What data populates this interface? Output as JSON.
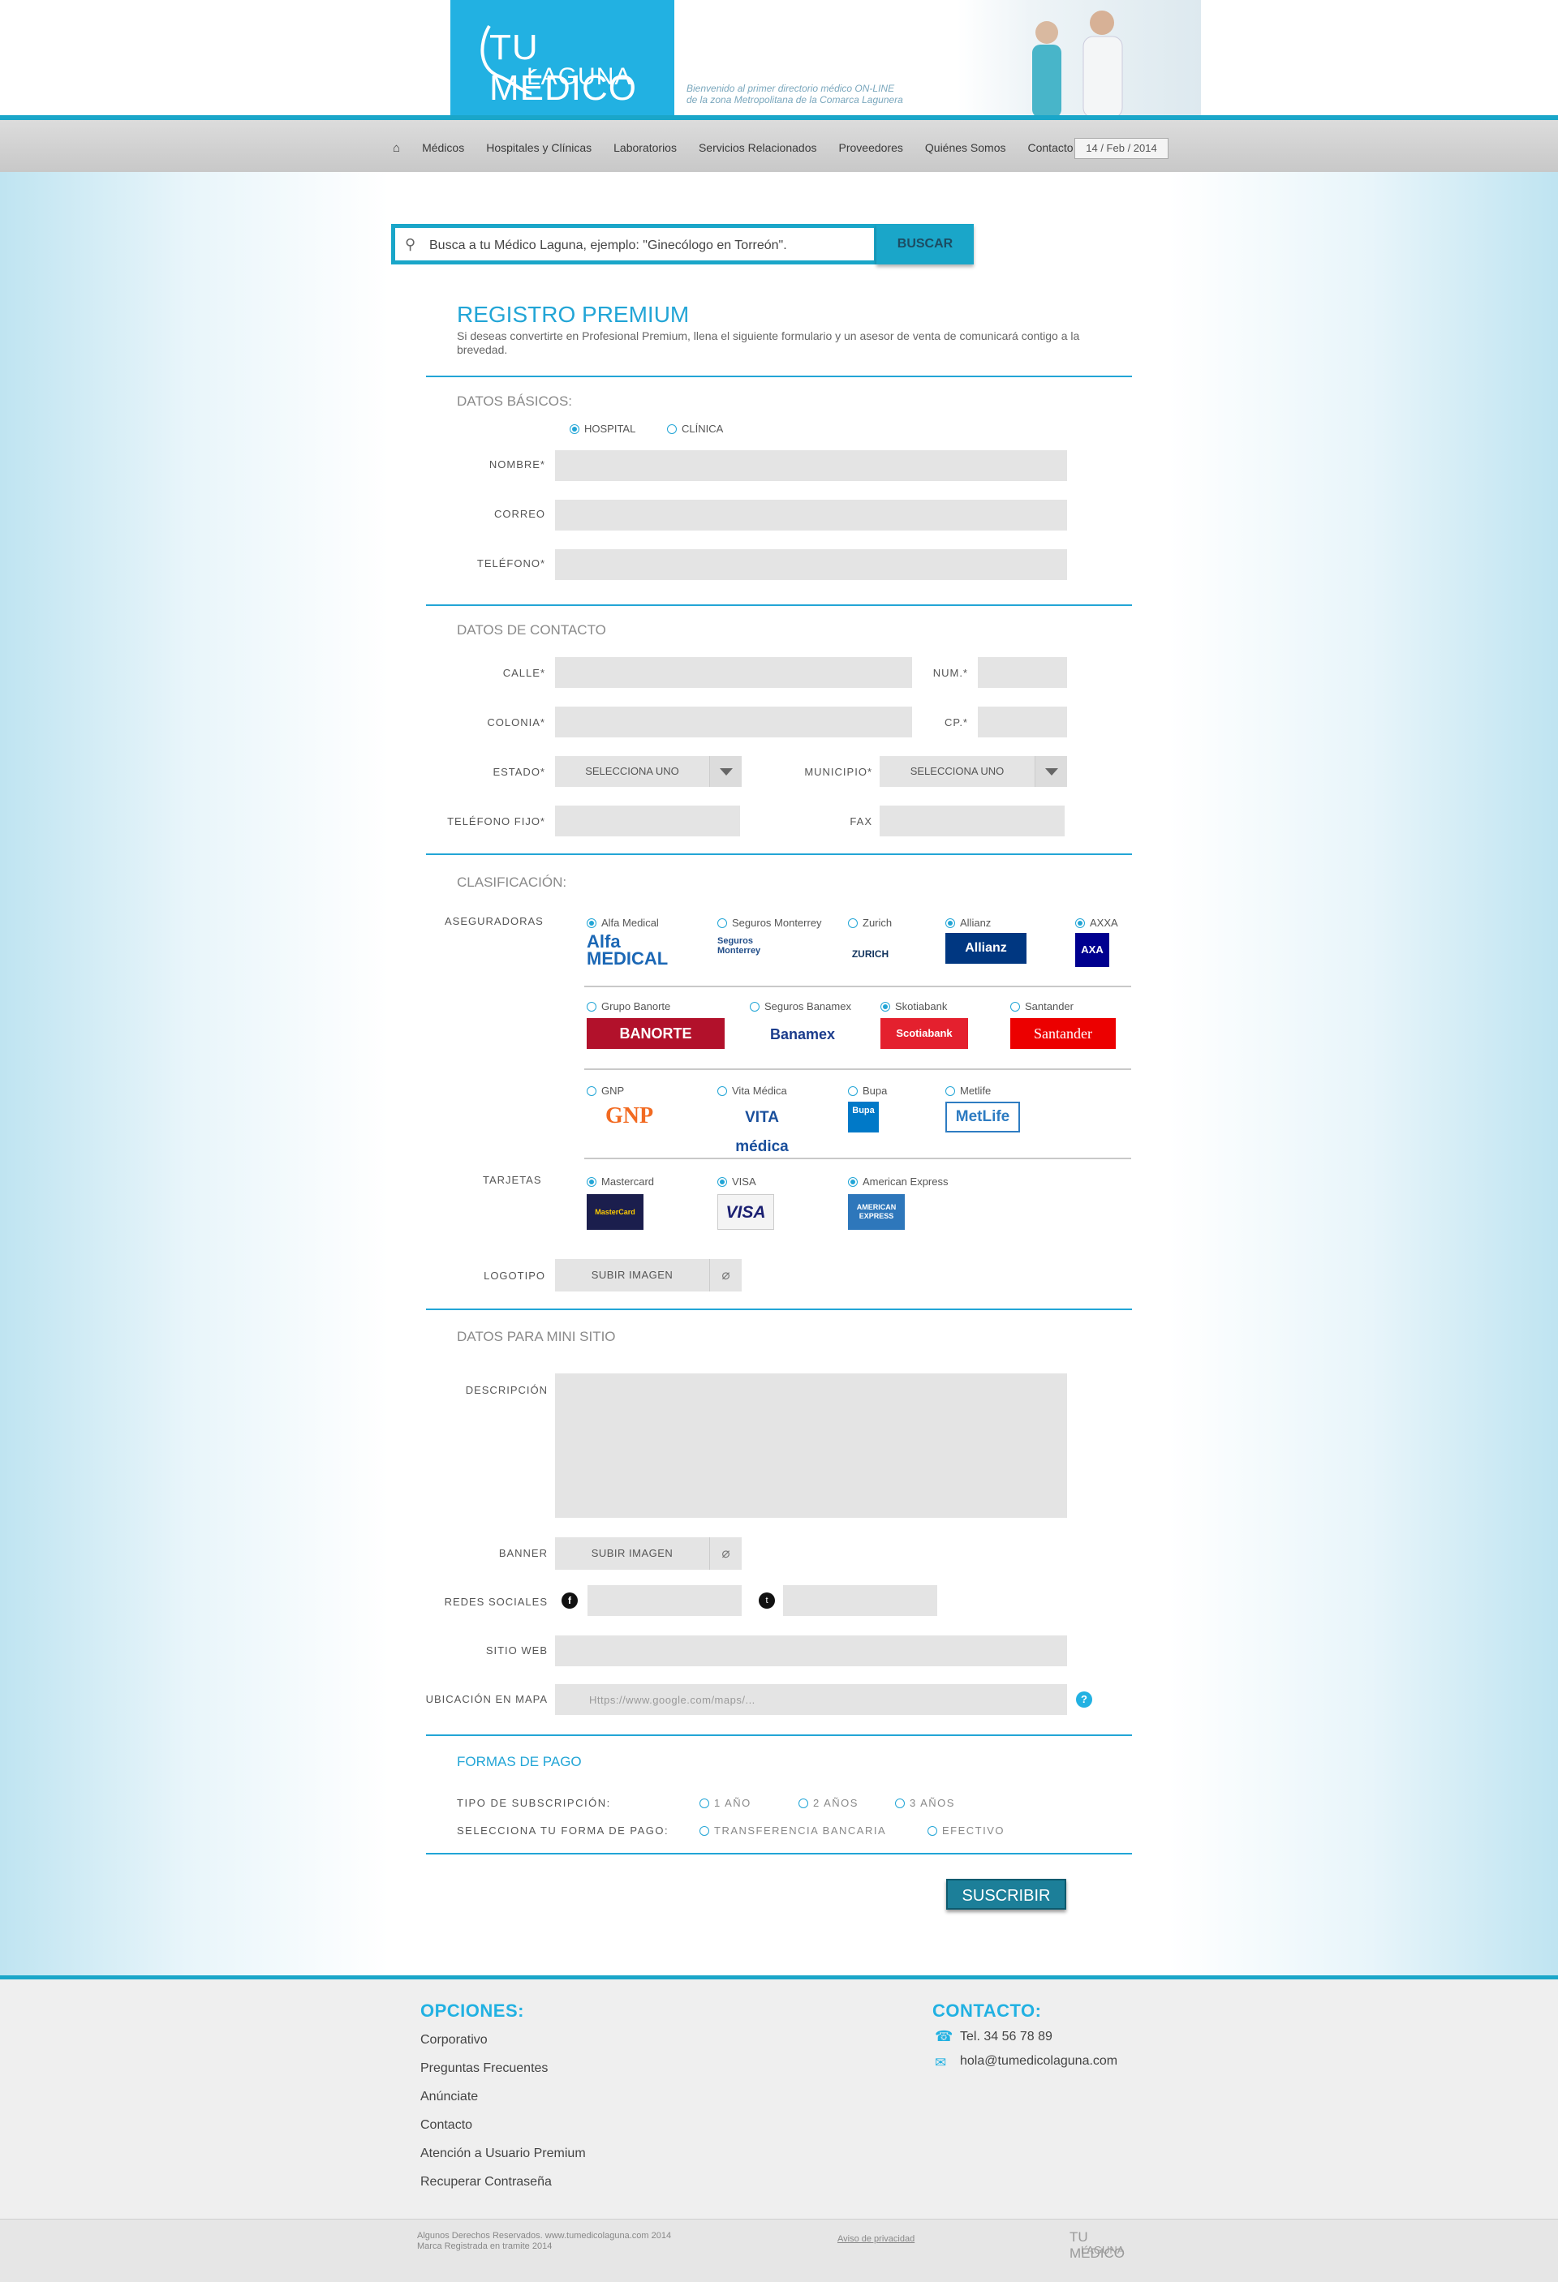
{
  "header": {
    "logo_line1": "TU MÉDICO",
    "logo_line2": "LAGUNA",
    "tagline1": "Bienvenido al primer directorio médico ON-LINE",
    "tagline2": "de la zona Metropolitana de la Comarca Lagunera"
  },
  "nav": {
    "items": [
      "Médicos",
      "Hospitales y Clínicas",
      "Laboratorios",
      "Servicios Relacionados",
      "Proveedores",
      "Quiénes Somos",
      "Contacto"
    ],
    "date": "14 / Feb / 2014"
  },
  "search": {
    "placeholder": "Busca a tu Médico Laguna, ejemplo: \"Ginecólogo en Torreón\".",
    "button": "BUSCAR"
  },
  "form": {
    "title": "REGISTRO PREMIUM",
    "intro": "Si deseas convertirte en Profesional Premium, llena el siguiente formulario y un asesor de venta de comunicará contigo a la brevedad.",
    "basic": {
      "section": "DATOS BÁSICOS:",
      "type_hospital": "HOSPITAL",
      "type_clinica": "CLÍNICA",
      "nombre": "NOMBRE*",
      "correo": "CORREO",
      "telefono": "TELÉFONO*"
    },
    "contact": {
      "section": "DATOS DE CONTACTO",
      "calle": "CALLE*",
      "num": "NUM.*",
      "colonia": "COLONIA*",
      "cp": "CP.*",
      "estado": "ESTADO*",
      "estado_value": "SELECCIONA UNO",
      "municipio": "MUNICIPIO*",
      "municipio_value": "SELECCIONA UNO",
      "tel_fijo": "TELÉFONO FIJO*",
      "fax": "FAX"
    },
    "classification": {
      "section": "CLASIFICACIÓN:",
      "aseguradoras": "ASEGURADORAS",
      "insurers": [
        {
          "name": "Alfa Medical",
          "logo": "Alfa MEDICAL"
        },
        {
          "name": "Seguros Monterrey",
          "logo": "Seguros Monterrey"
        },
        {
          "name": "Zurich",
          "logo": "ZURICH"
        },
        {
          "name": "Allianz",
          "logo": "Allianz"
        },
        {
          "name": "AXXA",
          "logo": "AXA"
        },
        {
          "name": "Grupo Banorte",
          "logo": "BANORTE"
        },
        {
          "name": "Seguros Banamex",
          "logo": "Banamex"
        },
        {
          "name": "Skotiabank",
          "logo": "Scotiabank"
        },
        {
          "name": "Santander",
          "logo": "Santander"
        },
        {
          "name": "GNP",
          "logo": "GNP"
        },
        {
          "name": "Vita Médica",
          "logo": "VITA médica"
        },
        {
          "name": "Bupa",
          "logo": "Bupa"
        },
        {
          "name": "Metlife",
          "logo": "MetLife"
        }
      ],
      "tarjetas": "TARJETAS",
      "cards": [
        {
          "name": "Mastercard",
          "logo": "MasterCard"
        },
        {
          "name": "VISA",
          "logo": "VISA"
        },
        {
          "name": "American Express",
          "logo": "AMERICAN EXPRESS"
        }
      ],
      "logotipo": "LOGOTIPO",
      "upload": "SUBIR IMAGEN"
    },
    "mini": {
      "section": "DATOS PARA MINI SITIO",
      "descripcion": "DESCRIPCIÓN",
      "banner": "BANNER",
      "upload": "SUBIR IMAGEN",
      "redes": "REDES SOCIALES",
      "sitio": "SITIO WEB",
      "mapa": "UBICACIÓN EN MAPA",
      "mapa_placeholder": "Https://www.google.com/maps/..."
    },
    "payment": {
      "section": "FORMAS DE PAGO",
      "tipo": "TIPO DE SUBSCRIPCIÓN:",
      "y1": "1 AÑO",
      "y2": "2 AÑOS",
      "y3": "3 AÑOS",
      "forma": "SELECCIONA TU FORMA DE PAGO:",
      "transfer": "TRANSFERENCIA BANCARIA",
      "cash": "EFECTIVO"
    },
    "submit": "SUSCRIBIR"
  },
  "footer": {
    "options_title": "OPCIONES:",
    "options": [
      "Corporativo",
      "Preguntas Frecuentes",
      "Anúnciate",
      "Contacto",
      "Atención a Usuario Premium",
      "Recuperar Contraseña"
    ],
    "contact_title": "CONTACTO:",
    "phone": "Tel. 34 56 78 89",
    "email": "hola@tumedicolaguna.com",
    "rights1": "Algunos Derechos Reservados. www.tumedicolaguna.com 2014",
    "rights2": "Marca Registrada en tramite 2014",
    "privacy": "Aviso de privacidad",
    "logo_line1": "TU MÉDICO",
    "logo_line2": "LAGUNA"
  },
  "colors": {
    "accent": "#22a5d6",
    "header_blue": "#22b1e2",
    "button": "#1c7f99"
  }
}
